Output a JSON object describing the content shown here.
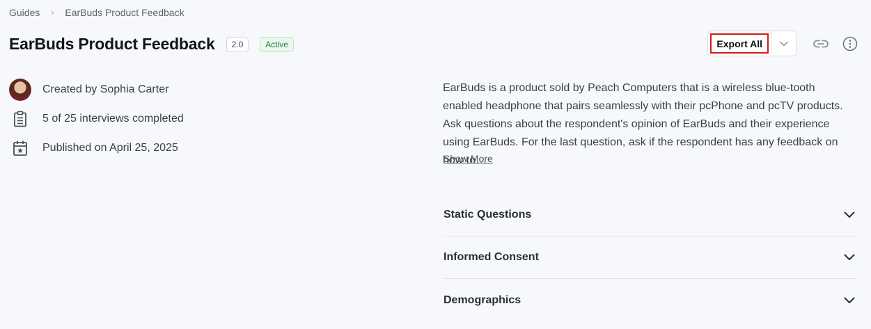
{
  "breadcrumb": {
    "items": [
      "Guides",
      "EarBuds Product Feedback"
    ],
    "separator": "›"
  },
  "header": {
    "title": "EarBuds Product Feedback",
    "version": "2.0",
    "status": "Active"
  },
  "actions": {
    "export_label": "Export All",
    "dropdown_icon": "chevron-down-icon",
    "link_icon": "link-icon",
    "more_icon": "more-vertical-icon"
  },
  "meta": {
    "created": "Created by Sophia Carter",
    "progress": "5 of 25 interviews completed",
    "published": "Published on April 25, 2025"
  },
  "description": {
    "text": "EarBuds is a product sold by Peach Computers that is a wireless blue-tooth enabled headphone that pairs seamlessly with their pcPhone and pcTV products. Ask questions about the respondent's opinion of EarBuds and their experience using EarBuds. For the last question, ask if the respondent has any feedback on how to…",
    "show_more": "Show More"
  },
  "sections": [
    {
      "label": "Static Questions"
    },
    {
      "label": "Informed Consent"
    },
    {
      "label": "Demographics"
    }
  ],
  "colors": {
    "accent_red": "#d11a1a",
    "active_green": "#1e7b3a",
    "background": "#f7f8fb"
  }
}
